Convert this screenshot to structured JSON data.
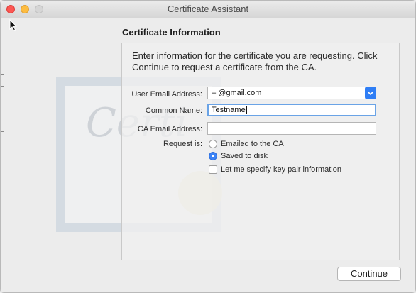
{
  "window": {
    "title": "Certificate Assistant"
  },
  "section": {
    "title": "Certificate Information",
    "intro": "Enter information for the certificate you are requesting. Click Continue to request a certificate from the CA."
  },
  "background": {
    "certificate_script": "Certi"
  },
  "form": {
    "user_email_label": "User Email Address:",
    "user_email_value": "–               @gmail.com",
    "common_name_label": "Common Name:",
    "common_name_value": "Testname",
    "ca_email_label": "CA Email Address:",
    "ca_email_value": "",
    "request_is_label": "Request is:",
    "options": [
      {
        "label": "Emailed to the CA",
        "selected": false
      },
      {
        "label": "Saved to disk",
        "selected": true
      }
    ],
    "key_pair_label": "Let me specify key pair information",
    "key_pair_checked": false
  },
  "buttons": {
    "continue_label": "Continue"
  },
  "colors": {
    "accent": "#2f7ef5",
    "focus_ring": "#6aa3e6",
    "close": "#fc5753",
    "minimize": "#fdbc40"
  }
}
